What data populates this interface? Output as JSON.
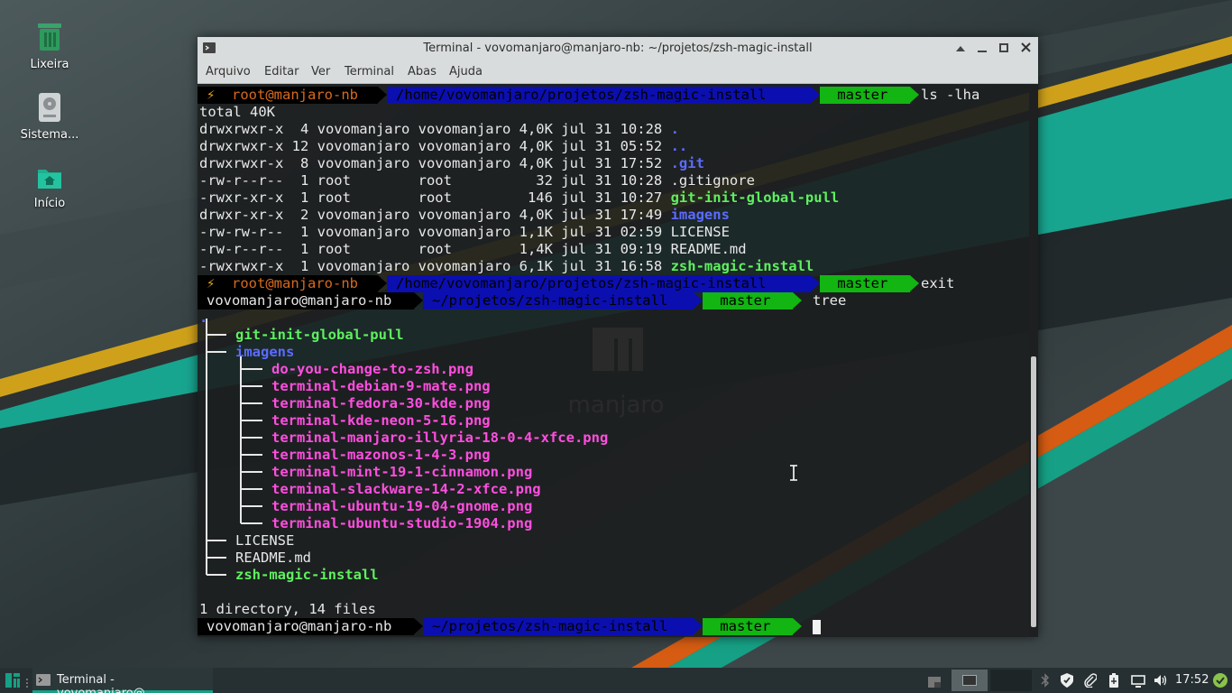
{
  "desktop": {
    "icons": [
      {
        "label": "Lixeira"
      },
      {
        "label": "Sistema..."
      },
      {
        "label": "Início"
      }
    ]
  },
  "window": {
    "title": "Terminal - vovomanjaro@manjaro-nb: ~/projetos/zsh-magic-install",
    "menu": [
      "Arquivo",
      "Editar",
      "Ver",
      "Terminal",
      "Abas",
      "Ajuda"
    ]
  },
  "watermark": {
    "text": "manjaro"
  },
  "terminal": {
    "prompt1": {
      "bolt": "⚡",
      "user": "root@manjaro-nb",
      "path": "/home/vovomanjaro/projetos/zsh-magic-install",
      "branch": " master",
      "command": "ls -lha"
    },
    "ls_total": "total 40K",
    "ls_rows": [
      {
        "meta": "drwxrwxr-x  4 vovomanjaro vovomanjaro 4,0K jul 31 10:28 ",
        "name": ".",
        "style": "blue"
      },
      {
        "meta": "drwxrwxr-x 12 vovomanjaro vovomanjaro 4,0K jul 31 05:52 ",
        "name": "..",
        "style": "blue"
      },
      {
        "meta": "drwxrwxr-x  8 vovomanjaro vovomanjaro 4,0K jul 31 17:52 ",
        "name": ".git",
        "style": "blue"
      },
      {
        "meta": "-rw-r--r--  1 root        root          32 jul 31 10:28 ",
        "name": ".gitignore",
        "style": "plain"
      },
      {
        "meta": "-rwxr-xr-x  1 root        root         146 jul 31 10:27 ",
        "name": "git-init-global-pull",
        "style": "green"
      },
      {
        "meta": "drwxr-xr-x  2 vovomanjaro vovomanjaro 4,0K jul 31 17:49 ",
        "name": "imagens",
        "style": "blue"
      },
      {
        "meta": "-rw-rw-r--  1 vovomanjaro vovomanjaro 1,1K jul 31 02:59 ",
        "name": "LICENSE",
        "style": "plain"
      },
      {
        "meta": "-rw-r--r--  1 root        root        1,4K jul 31 09:19 ",
        "name": "README.md",
        "style": "plain"
      },
      {
        "meta": "-rwxrwxr-x  1 vovomanjaro vovomanjaro 6,1K jul 31 16:58 ",
        "name": "zsh-magic-install",
        "style": "green"
      }
    ],
    "prompt2": {
      "bolt": "⚡",
      "user": "root@manjaro-nb",
      "path": "/home/vovomanjaro/projetos/zsh-magic-install",
      "branch": " master",
      "command": "exit"
    },
    "prompt3": {
      "user": "vovomanjaro@manjaro-nb",
      "path": "~/projetos/zsh-magic-install",
      "branch": " master",
      "command": "tree"
    },
    "tree_root": ".",
    "tree": [
      {
        "name": "git-init-global-pull",
        "style": "green",
        "depth": 1
      },
      {
        "name": "imagens",
        "style": "blue",
        "depth": 1
      },
      {
        "name": "do-you-change-to-zsh.png",
        "style": "magenta",
        "depth": 2
      },
      {
        "name": "terminal-debian-9-mate.png",
        "style": "magenta",
        "depth": 2
      },
      {
        "name": "terminal-fedora-30-kde.png",
        "style": "magenta",
        "depth": 2
      },
      {
        "name": "terminal-kde-neon-5-16.png",
        "style": "magenta",
        "depth": 2
      },
      {
        "name": "terminal-manjaro-illyria-18-0-4-xfce.png",
        "style": "magenta",
        "depth": 2
      },
      {
        "name": "terminal-mazonos-1-4-3.png",
        "style": "magenta",
        "depth": 2
      },
      {
        "name": "terminal-mint-19-1-cinnamon.png",
        "style": "magenta",
        "depth": 2
      },
      {
        "name": "terminal-slackware-14-2-xfce.png",
        "style": "magenta",
        "depth": 2
      },
      {
        "name": "terminal-ubuntu-19-04-gnome.png",
        "style": "magenta",
        "depth": 2
      },
      {
        "name": "terminal-ubuntu-studio-1904.png",
        "style": "magenta",
        "depth": 2
      },
      {
        "name": "LICENSE",
        "style": "plain",
        "depth": 1
      },
      {
        "name": "README.md",
        "style": "plain",
        "depth": 1
      },
      {
        "name": "zsh-magic-install",
        "style": "green",
        "depth": 1
      }
    ],
    "summary": "1 directory, 14 files",
    "prompt4": {
      "user": "vovomanjaro@manjaro-nb",
      "path": "~/projetos/zsh-magic-install",
      "branch": " master",
      "command": ""
    }
  },
  "taskbar": {
    "task_label": "Terminal - vovomanjaro@...",
    "clock": "17:52",
    "icons": [
      "manjaro-menu-icon",
      "separator-handle-icon",
      "show-desktop-icon",
      "workspace-1-icon",
      "workspace-2-icon",
      "bluetooth-icon",
      "shield-icon",
      "clipboard-icon",
      "battery-icon",
      "display-icon",
      "volume-icon",
      "update-notifier-icon"
    ]
  },
  "colors": {
    "accent": "#16a085",
    "path_segment": "#0b0fb0",
    "git_segment": "#12b512",
    "dir": "#5c6bff",
    "exec": "#5ff05f",
    "image": "#ff4ee0"
  }
}
